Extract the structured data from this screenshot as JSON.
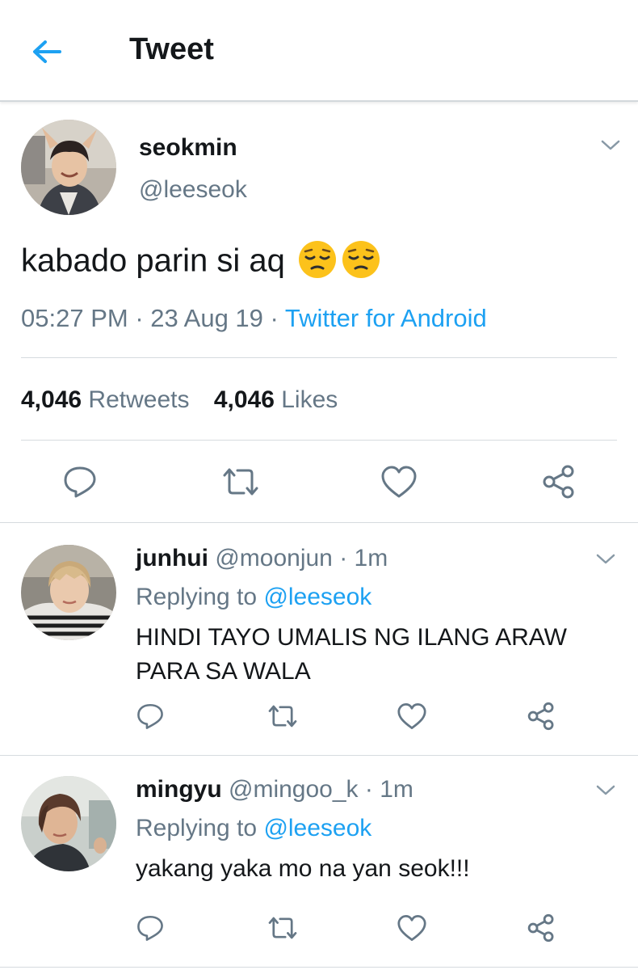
{
  "header": {
    "title": "Tweet",
    "back_icon": "arrow-left-icon",
    "accent": "#1da1f2"
  },
  "tweet": {
    "display_name": "seokmin",
    "handle": "@leeseok",
    "text": "kabado parin si aq",
    "emojis": [
      "pensive-face",
      "pensive-face"
    ],
    "time": "05:27 PM",
    "sep1": " · ",
    "date": "23 Aug 19",
    "sep2": " · ",
    "source": "Twitter for Android",
    "retweets_count": "4,046",
    "retweets_label": "Retweets",
    "likes_count": "4,046",
    "likes_label": "Likes",
    "actions": [
      "reply-icon",
      "retweet-icon",
      "like-icon",
      "share-icon"
    ]
  },
  "replies": [
    {
      "display_name": "junhui",
      "handle": "@moonjun",
      "time": "1m",
      "sep": " · ",
      "replying_label": "Replying to",
      "replying_to": "@leeseok",
      "text_line1": "HINDI TAYO UMALIS NG ILANG ARAW",
      "text_line2": "PARA SA WALA"
    },
    {
      "display_name": "mingyu",
      "handle": "@mingoo_k",
      "time": "1m",
      "sep": " · ",
      "replying_label": "Replying to",
      "replying_to": "@leeseok",
      "text_line1": "yakang yaka mo na yan seok!!!",
      "text_line2": ""
    }
  ],
  "colors": {
    "text": "#14171a",
    "muted": "#657786",
    "link": "#1da1f2",
    "divider": "#d6dbdf"
  }
}
